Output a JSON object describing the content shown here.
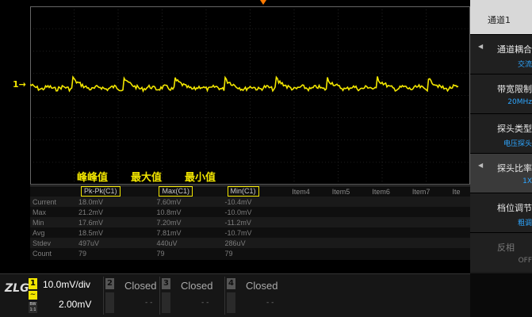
{
  "channel_marker": "1",
  "annotations": [
    "峰峰值",
    "最大值",
    "最小值"
  ],
  "measurements": {
    "headers": [
      "Pk-Pk(C1)",
      "Max(C1)",
      "Min(C1)",
      "Item4",
      "Item5",
      "Item6",
      "Item7",
      "Ite"
    ],
    "rows": [
      {
        "label": "Current",
        "values": [
          "18.0mV",
          "7.60mV",
          "-10.4mV"
        ]
      },
      {
        "label": "Max",
        "values": [
          "21.2mV",
          "10.8mV",
          "-10.0mV"
        ]
      },
      {
        "label": "Min",
        "values": [
          "17.6mV",
          "7.20mV",
          "-11.2mV"
        ]
      },
      {
        "label": "Avg",
        "values": [
          "18.5mV",
          "7.81mV",
          "-10.7mV"
        ]
      },
      {
        "label": "Stdev",
        "values": [
          "497uV",
          "440uV",
          "286uV"
        ]
      },
      {
        "label": "Count",
        "values": [
          "79",
          "79",
          "79"
        ]
      }
    ]
  },
  "menu": {
    "title": "通道1",
    "items": [
      {
        "label": "通道耦合",
        "value": "交流"
      },
      {
        "label": "带宽限制",
        "value": "20MHz"
      },
      {
        "label": "探头类型",
        "value": "电压探头"
      },
      {
        "label": "探头比率",
        "value": "1X"
      },
      {
        "label": "档位调节",
        "value": "粗调"
      },
      {
        "label": "反相",
        "value": "OFF"
      }
    ]
  },
  "status": {
    "logo": "ZLG",
    "ch1": {
      "num": "1",
      "scale": "10.0mV/div",
      "offset": "2.00mV",
      "bw_top": "BW",
      "bw_bot": "1:1"
    },
    "others": [
      {
        "num": "2",
        "state": "Closed",
        "dash": "- -"
      },
      {
        "num": "3",
        "state": "Closed",
        "dash": "- -"
      },
      {
        "num": "4",
        "state": "Closed",
        "dash": "- -"
      }
    ]
  },
  "colors": {
    "ch1": "#f2e600",
    "accent": "#2ea6ff",
    "trigger": "#ff7a00"
  }
}
